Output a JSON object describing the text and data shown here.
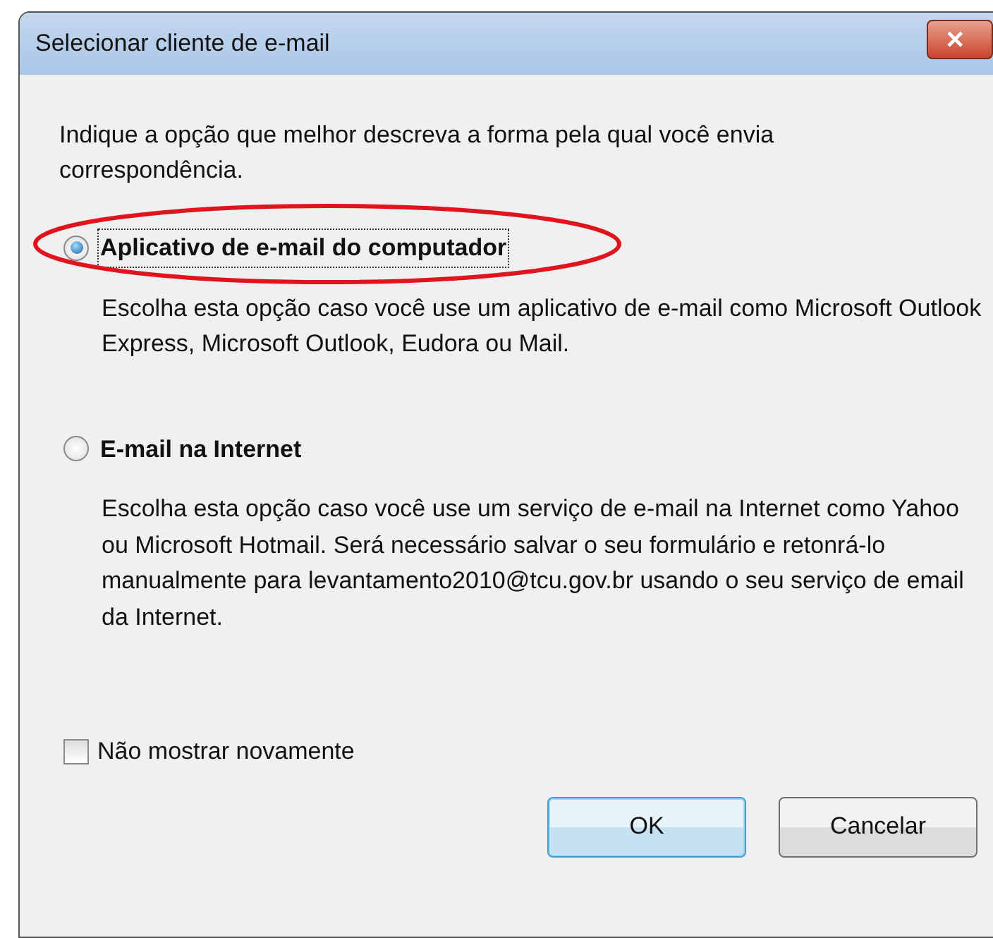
{
  "window": {
    "title": "Selecionar cliente de e-mail",
    "close_label": "✕"
  },
  "intro": "Indique a opção que melhor descreva a forma pela qual você envia correspondência.",
  "options": [
    {
      "label": "Aplicativo de e-mail do computador",
      "selected": true,
      "focused": true,
      "circled": true,
      "description": "Escolha esta opção caso você use um aplicativo de e-mail como Microsoft Outlook Express, Microsoft Outlook, Eudora ou Mail."
    },
    {
      "label": "E-mail na Internet",
      "selected": false,
      "focused": false,
      "circled": false,
      "description": "Escolha esta opção caso você use um serviço de e-mail na Internet como Yahoo ou Microsoft Hotmail. Será necessário salvar o seu formulário e retonrá-lo manualmente para levantamento2010@tcu.gov.br usando o seu serviço de email da Internet."
    }
  ],
  "dont_show_again": {
    "label": "Não mostrar novamente",
    "checked": false
  },
  "buttons": [
    {
      "label": "OK",
      "default": true
    },
    {
      "label": "Cancelar",
      "default": false
    }
  ]
}
